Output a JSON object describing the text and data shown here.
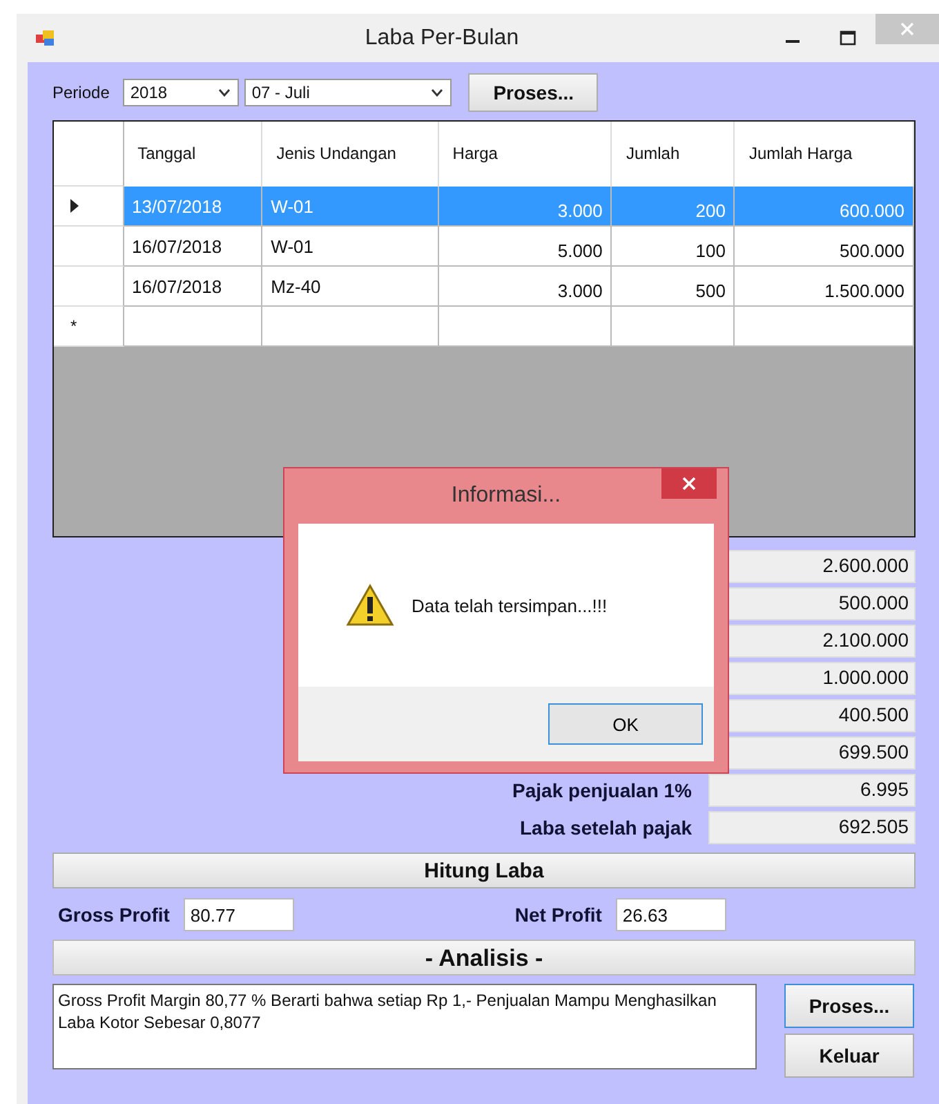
{
  "window": {
    "title": "Laba Per-Bulan"
  },
  "periode": {
    "label": "Periode",
    "year": "2018",
    "month": "07 - Juli",
    "button": "Proses..."
  },
  "grid": {
    "columns": [
      "Tanggal",
      "Jenis Undangan",
      "Harga",
      "Jumlah",
      "Jumlah Harga"
    ],
    "rows": [
      {
        "selected": true,
        "cells": [
          "13/07/2018",
          "W-01",
          "3.000",
          "200",
          "600.000"
        ]
      },
      {
        "selected": false,
        "cells": [
          "16/07/2018",
          "W-01",
          "5.000",
          "100",
          "500.000"
        ]
      },
      {
        "selected": false,
        "cells": [
          "16/07/2018",
          "Mz-40",
          "3.000",
          "500",
          "1.500.000"
        ]
      }
    ],
    "new_row_marker": "*"
  },
  "summary": [
    {
      "value": "2.600.000"
    },
    {
      "value": "500.000"
    },
    {
      "value": "2.100.000"
    },
    {
      "value": "1.000.000"
    },
    {
      "value": "400.500"
    },
    {
      "value": "699.500"
    },
    {
      "label": "Pajak penjualan 1%",
      "value": "6.995"
    },
    {
      "label": "Laba setelah pajak",
      "value": "692.505"
    }
  ],
  "hitung_button": "Hitung Laba",
  "gross_profit": {
    "label": "Gross Profit",
    "value": "80.77"
  },
  "net_profit": {
    "label": "Net Profit",
    "value": "26.63"
  },
  "analisis_header": "- Analisis -",
  "analisis_text": "Gross Profit Margin 80,77 % Berarti bahwa setiap Rp 1,- Penjualan Mampu Menghasilkan Laba Kotor Sebesar 0,8077",
  "buttons": [
    "Proses...",
    "Keluar"
  ],
  "dialog": {
    "title": "Informasi...",
    "message": "Data telah tersimpan...!!!",
    "button": "OK"
  }
}
